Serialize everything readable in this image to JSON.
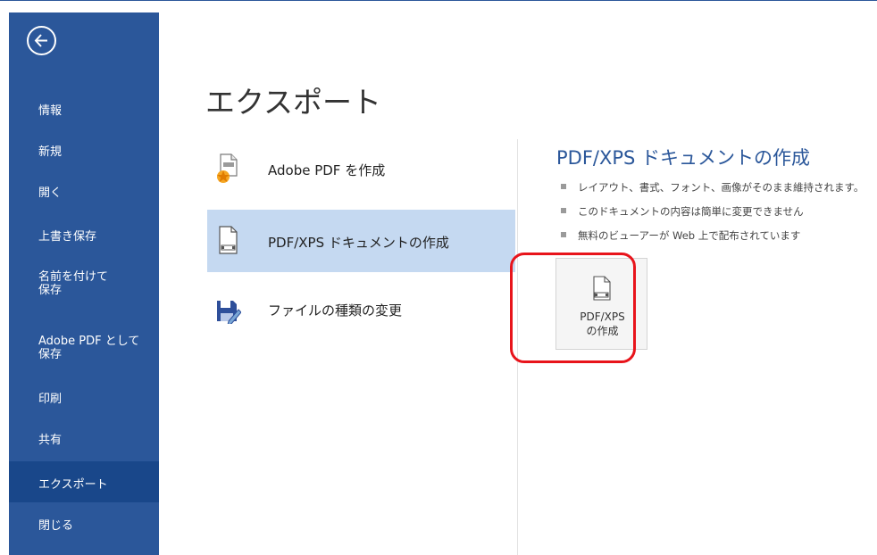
{
  "sidebar": {
    "back_label": "←",
    "items": [
      {
        "label": "情報"
      },
      {
        "label": "新規"
      },
      {
        "label": "開く"
      },
      {
        "label": "上書き保存"
      },
      {
        "label": "名前を付けて\n保存"
      },
      {
        "label": "Adobe PDF として\n保存"
      },
      {
        "label": "印刷"
      },
      {
        "label": "共有"
      },
      {
        "label": "エクスポート",
        "active": true
      },
      {
        "label": "閉じる"
      }
    ]
  },
  "main": {
    "title": "エクスポート",
    "options": [
      {
        "label": "Adobe PDF を作成",
        "icon": "adobe-pdf-icon"
      },
      {
        "label": "PDF/XPS ドキュメントの作成",
        "icon": "pdf-xps-document-icon",
        "selected": true
      },
      {
        "label": "ファイルの種類の変更",
        "icon": "save-edit-icon"
      }
    ]
  },
  "panel": {
    "title": "PDF/XPS ドキュメントの作成",
    "bullets": [
      "レイアウト、書式、フォント、画像がそのまま維持されます。",
      "このドキュメントの内容は簡単に変更できません",
      "無料のビューアーが Web 上で配布されています"
    ],
    "button_label": "PDF/XPS\nの作成"
  },
  "colors": {
    "sidebar_bg": "#2b579a",
    "sidebar_active": "#19478a",
    "selected_option": "#c5d9f1",
    "accent_title": "#2b579a",
    "highlight": "#e8141b"
  }
}
